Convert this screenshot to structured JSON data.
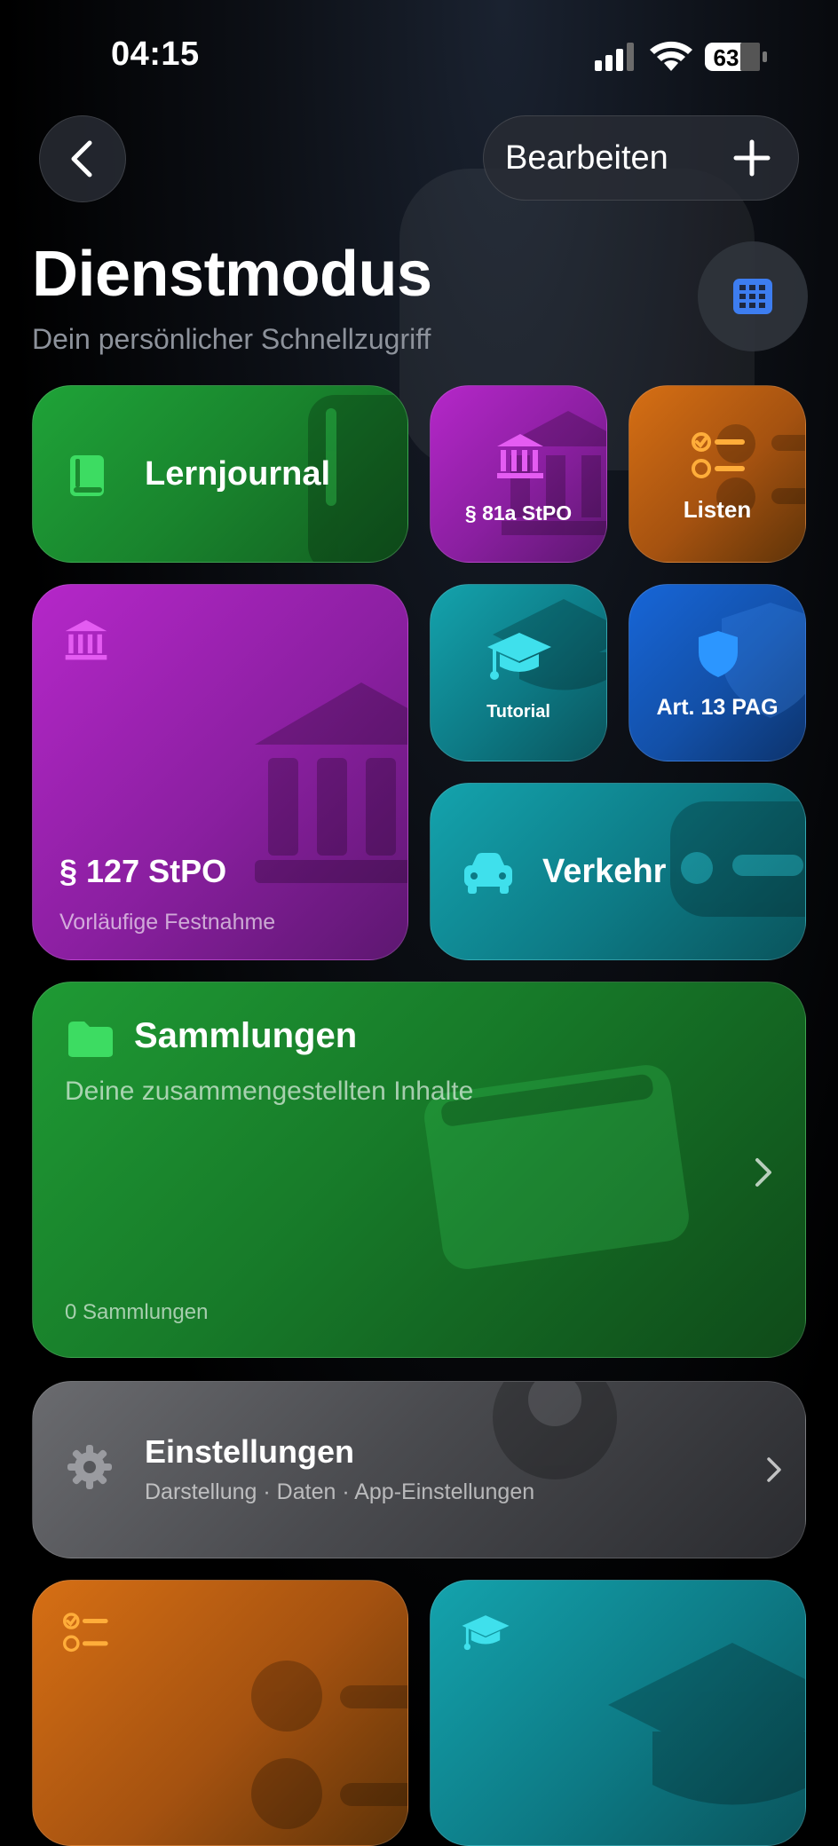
{
  "status_bar": {
    "time": "04:15",
    "battery": "63"
  },
  "nav": {
    "back": "back",
    "edit_label": "Bearbeiten"
  },
  "header": {
    "title": "Dienstmodus",
    "subtitle": "Dein persönlicher Schnellzugriff"
  },
  "tiles": {
    "lernjournal": {
      "label": "Lernjournal"
    },
    "stpo81a": {
      "label": "§ 81a StPO"
    },
    "listen": {
      "label": "Listen"
    },
    "stpo127": {
      "label": "§ 127 StPO",
      "sublabel": "Vorläufige Festnahme"
    },
    "tutorial": {
      "label": "Tutorial"
    },
    "pag": {
      "label": "Art. 13 PAG"
    },
    "verkehr": {
      "label": "Verkehr"
    },
    "sammlungen": {
      "label": "Sammlungen",
      "description": "Deine zusammengestellten Inhalte",
      "count": "0 Sammlungen"
    },
    "einstellungen": {
      "label": "Einstellungen",
      "description": "Darstellung · Daten · App-Einstellungen"
    }
  },
  "icons": {
    "back": "chevron-left-icon",
    "add": "plus-icon",
    "grid": "grid-icon",
    "lernjournal": "book-icon",
    "stpo": "courthouse-icon",
    "listen": "checklist-icon",
    "tutorial": "graduation-cap-icon",
    "pag": "shield-icon",
    "verkehr": "car-icon",
    "sammlungen": "folder-icon",
    "einstellungen": "gear-icon"
  },
  "colors": {
    "green": "#1fa338",
    "purple": "#b527c9",
    "orange": "#d66f14",
    "teal": "#14a3ad",
    "blue": "#1766d8",
    "gray": "#6a6b6f",
    "icon_blue": "#3d7df0",
    "icon_green": "#3ddc62",
    "icon_pink": "#e45cf2",
    "icon_cyan": "#3fe0ec"
  }
}
